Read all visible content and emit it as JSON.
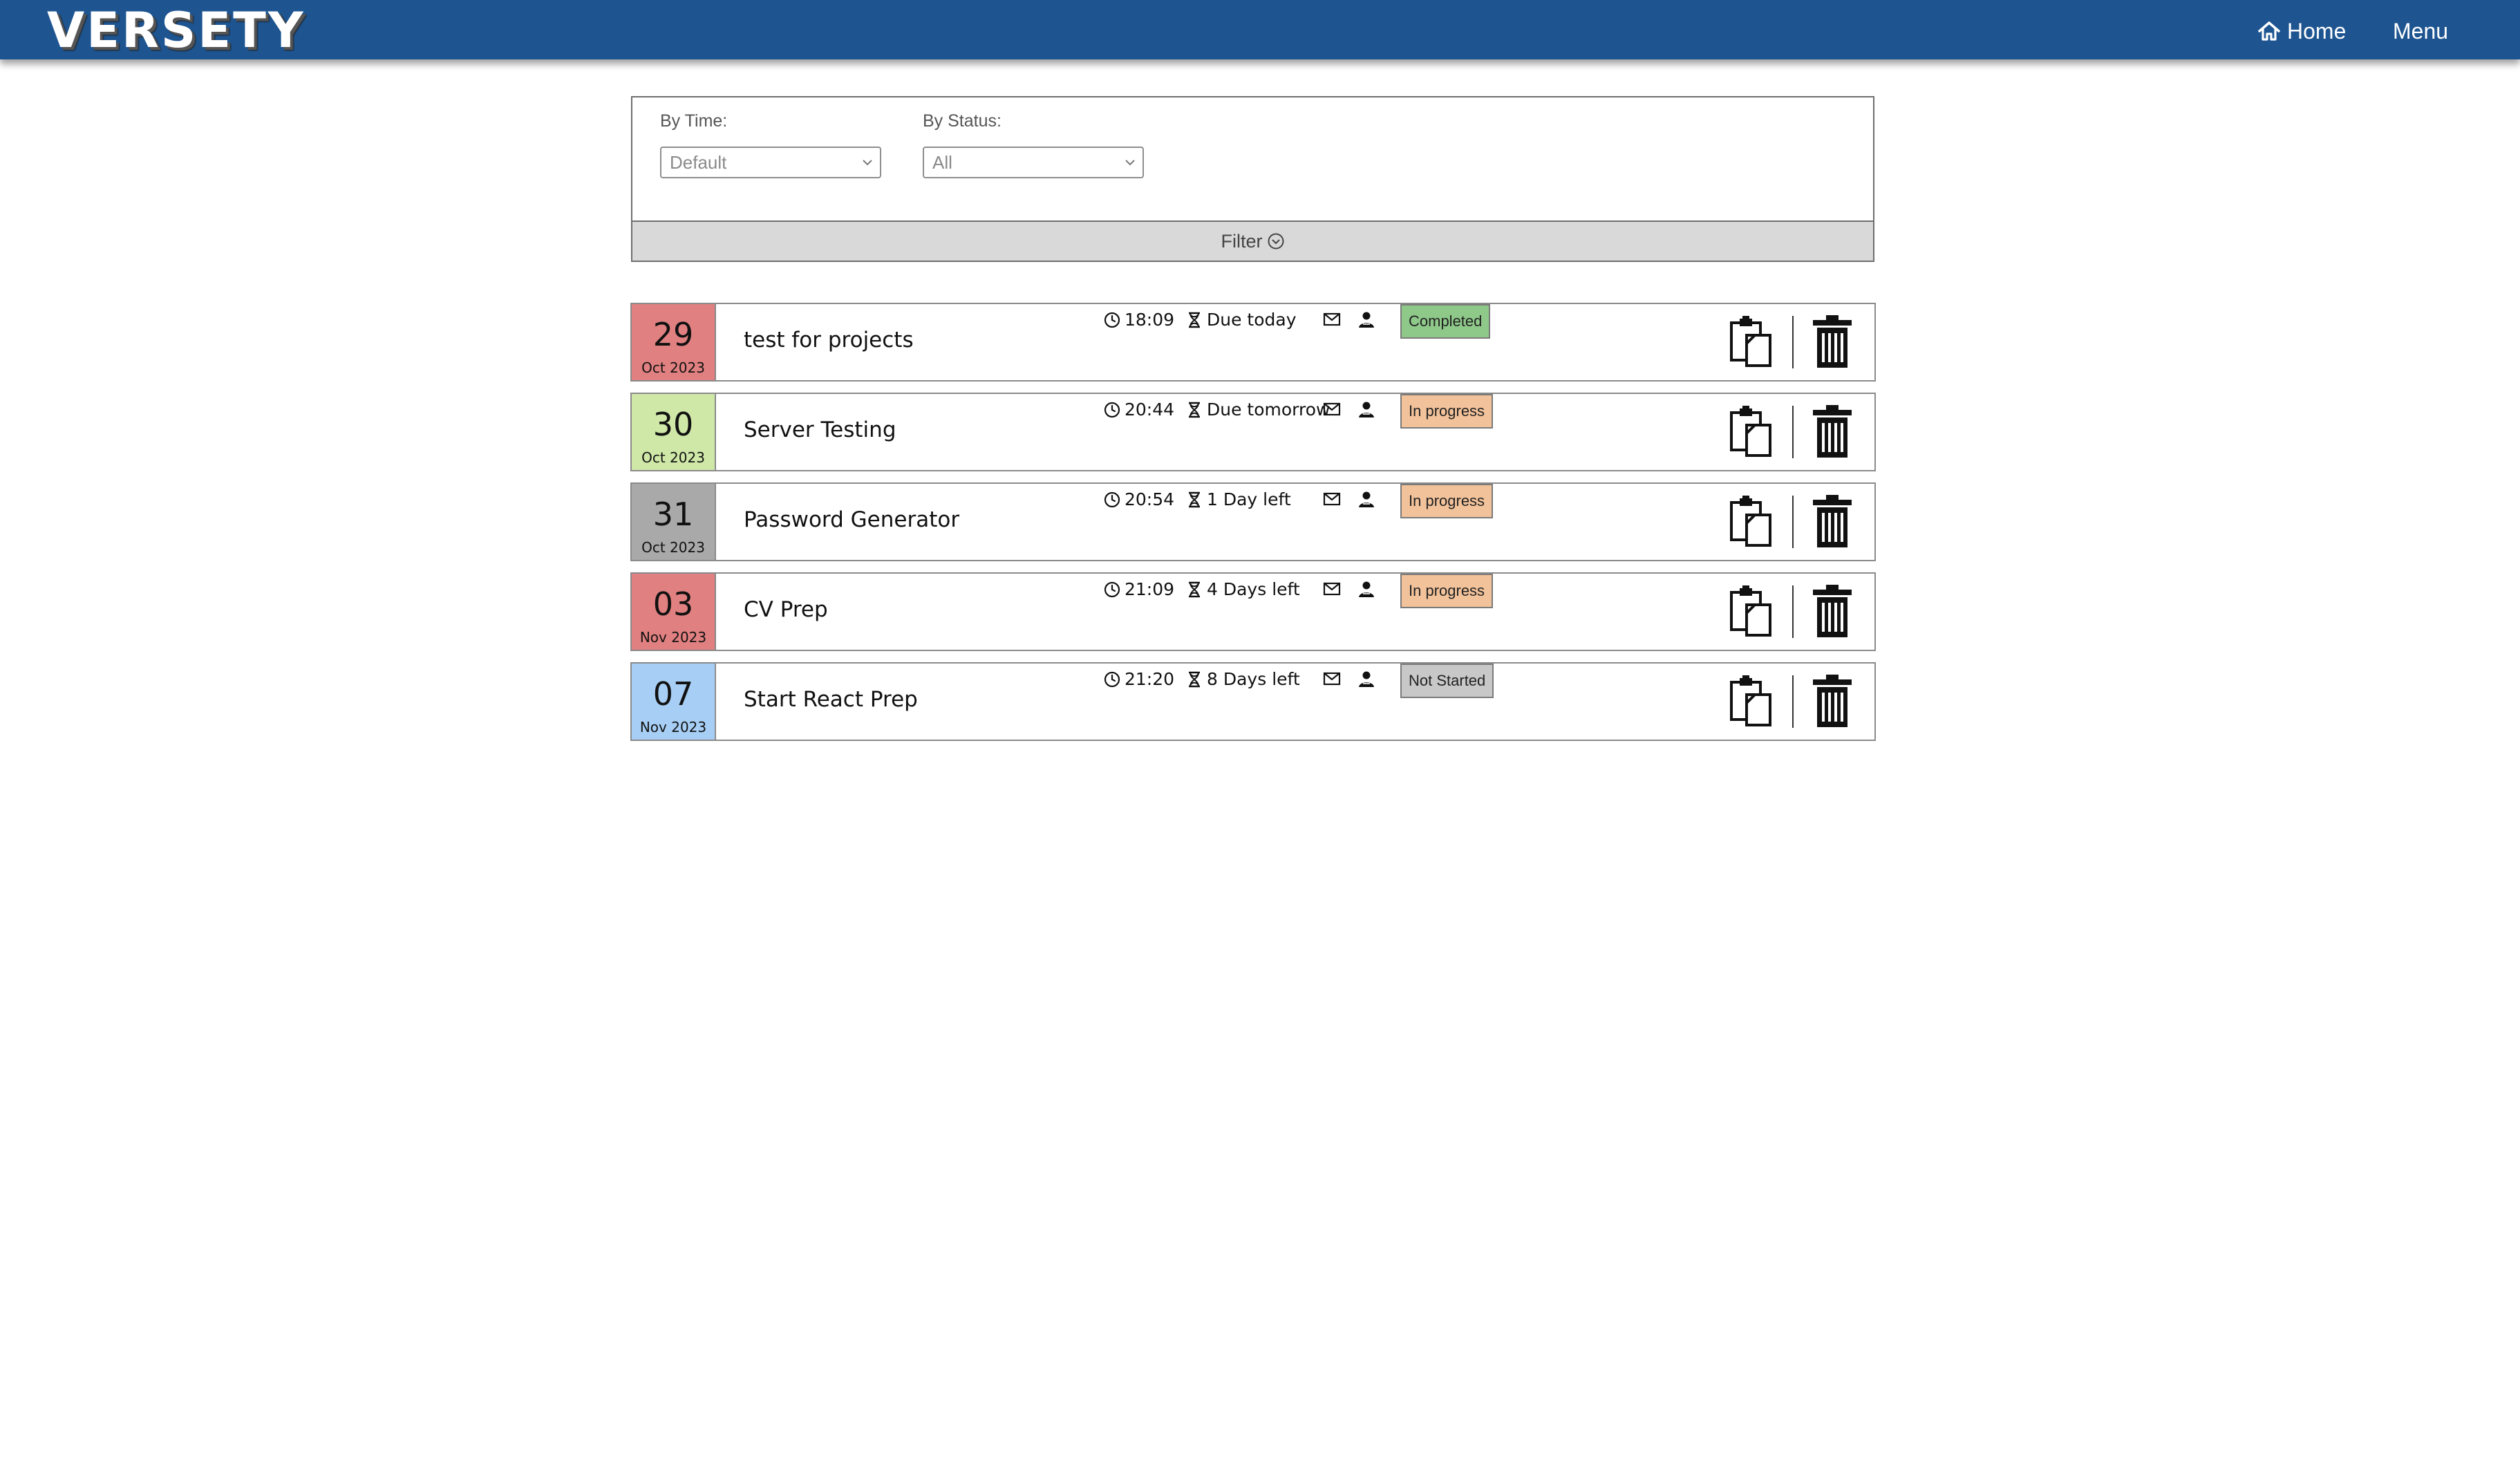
{
  "header": {
    "logo": "VERSETY",
    "home_label": "Home",
    "menu_label": "Menu",
    "bar_color": "#1e5591"
  },
  "filter": {
    "time_label": "By Time:",
    "time_value": "Default",
    "status_label": "By Status:",
    "status_value": "All",
    "toggle_label": "Filter"
  },
  "tasks": [
    {
      "day": "29",
      "month": "Oct 2023",
      "date_color": "#e08080",
      "title": "test for projects",
      "time": "18:09",
      "due": "Due today",
      "status": "Completed",
      "status_color": "#8fc98a"
    },
    {
      "day": "30",
      "month": "Oct 2023",
      "date_color": "#cfe8a8",
      "title": "Server Testing",
      "time": "20:44",
      "due": "Due tomorrow",
      "status": "In progress",
      "status_color": "#f2c29a"
    },
    {
      "day": "31",
      "month": "Oct 2023",
      "date_color": "#a9a9a9",
      "title": "Password Generator",
      "time": "20:54",
      "due": "1 Day left",
      "status": "In progress",
      "status_color": "#f2c29a"
    },
    {
      "day": "03",
      "month": "Nov 2023",
      "date_color": "#e08080",
      "title": "CV Prep",
      "time": "21:09",
      "due": "4 Days left",
      "status": "In progress",
      "status_color": "#f2c29a"
    },
    {
      "day": "07",
      "month": "Nov 2023",
      "date_color": "#a7cff5",
      "title": "Start React Prep",
      "time": "21:20",
      "due": "8 Days left",
      "status": "Not Started",
      "status_color": "#c8c8c8"
    }
  ]
}
